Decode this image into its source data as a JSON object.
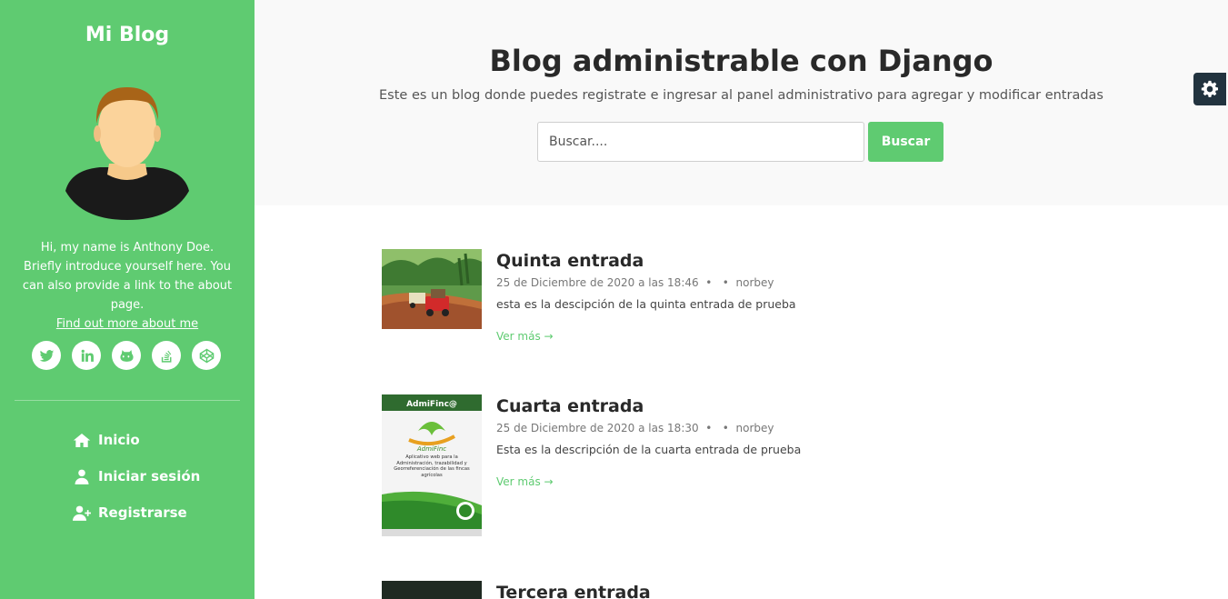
{
  "sidebar": {
    "blog_name": "Mi Blog",
    "bio": "Hi, my name is Anthony Doe. Briefly introduce yourself here. You can also provide a link to the about page.",
    "bio_link": "Find out more about me",
    "social": [
      "twitter-icon",
      "linkedin-icon",
      "github-icon",
      "stack-overflow-icon",
      "codepen-icon"
    ],
    "nav": [
      {
        "label": "Inicio",
        "icon": "home-icon"
      },
      {
        "label": "Iniciar sesión",
        "icon": "user-icon"
      },
      {
        "label": "Registrarse",
        "icon": "user-plus-icon"
      }
    ]
  },
  "header": {
    "title": "Blog administrable con Django",
    "subtitle": "Este es un blog donde puedes registrate e ingresar al panel administrativo para agregar y modificar entradas",
    "search_placeholder": "Buscar....",
    "search_button": "Buscar"
  },
  "posts": [
    {
      "title": "Quinta entrada",
      "date": "25 de Diciembre de 2020 a las 18:46",
      "author": "norbey",
      "description": "esta es la descipción de la quinta entrada de prueba",
      "link": "Ver más →"
    },
    {
      "title": "Cuarta entrada",
      "date": "25 de Diciembre de 2020 a las 18:30",
      "author": "norbey",
      "description": "Esta es la descripción de la cuarta entrada de prueba",
      "link": "Ver más →",
      "thumb_text": {
        "brand": "AdmiFinc@",
        "logo": "AdmiFinc",
        "caption": "Aplicativo web para la Administración, trazabilidad y Georreferenciación de las fincas agrícolas"
      }
    },
    {
      "title": "Tercera entrada"
    }
  ],
  "colors": {
    "accent": "#5fcb71",
    "gear_bg": "#22333f",
    "header_bg": "#f9f9f9"
  }
}
